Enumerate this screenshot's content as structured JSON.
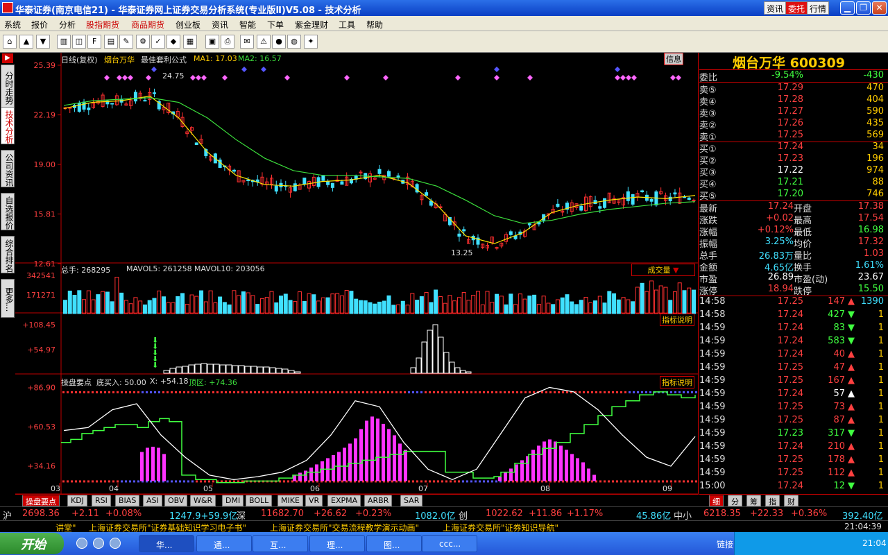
{
  "window": {
    "title": "华泰证券(南京电信21) - 华泰证券网上证券交易分析系统(专业版Ⅱ)V5.08 - 技术分析",
    "title_buttons": [
      "资讯",
      "委托",
      "行情"
    ]
  },
  "menu": [
    {
      "label": "系统",
      "red": false
    },
    {
      "label": "报价",
      "red": false
    },
    {
      "label": "分析",
      "red": false
    },
    {
      "label": "股指期货",
      "red": true
    },
    {
      "label": "商品期货",
      "red": true
    },
    {
      "label": "创业板",
      "red": false
    },
    {
      "label": "资讯",
      "red": false
    },
    {
      "label": "智能",
      "red": false
    },
    {
      "label": "下单",
      "red": false
    },
    {
      "label": "紫金理财",
      "red": false
    },
    {
      "label": "工具",
      "red": false
    },
    {
      "label": "帮助",
      "red": false
    }
  ],
  "left_nav": [
    "分时走势",
    "技术分析",
    "公司资讯",
    "自选报价",
    "综合排名",
    "更多..."
  ],
  "chart_header": {
    "period": "日线(复权)",
    "stock": "烟台万华",
    "formula": "最佳套利公式",
    "ma1": "MA1: 17.03",
    "ma2": "MA2: 16.57",
    "info_button": "信息",
    "high_label": "24.75",
    "low_label": "13.25"
  },
  "price_axis": [
    "25.39",
    "22.19",
    "19.00",
    "15.81",
    "12.61"
  ],
  "volume_header": {
    "label": "总手: 268295",
    "mavol5": "MAVOL5: 261258",
    "mavol10": "MAVOL10: 203056",
    "dropdown": "成交量",
    "axis": [
      "342541",
      "171271"
    ],
    "explain": "指标说明"
  },
  "ind1": {
    "axis": [
      "+108.45",
      "+54.97"
    ],
    "explain": "指标说明"
  },
  "ind2": {
    "name": "操盘要点",
    "buy": "底买入: 50.00",
    "x": "X: +54.18",
    "top": "顶区: +74.36",
    "axis": [
      "+86.90",
      "+60.53",
      "+34.16"
    ],
    "explain": "指标说明"
  },
  "x_axis": [
    "03",
    "04",
    "05",
    "06",
    "07",
    "08",
    "09"
  ],
  "indicator_tabs": [
    "操盘要点",
    "KDJ",
    "RSI",
    "BIAS",
    "ASI",
    "OBV",
    "W&R",
    "DMI",
    "BOLL",
    "MIKE",
    "VR",
    "EXPMA",
    "ARBR",
    "SAR"
  ],
  "quote": {
    "name": "烟台万华 600309",
    "weibi": {
      "label": "委比",
      "pct": "-9.54%",
      "diff": "-430"
    },
    "sell": [
      {
        "label": "卖⑤",
        "price": "17.29",
        "vol": "470"
      },
      {
        "label": "卖④",
        "price": "17.28",
        "vol": "404"
      },
      {
        "label": "卖③",
        "price": "17.27",
        "vol": "590"
      },
      {
        "label": "卖②",
        "price": "17.26",
        "vol": "435"
      },
      {
        "label": "卖①",
        "price": "17.25",
        "vol": "569"
      }
    ],
    "buy": [
      {
        "label": "买①",
        "price": "17.24",
        "vol": "34"
      },
      {
        "label": "买②",
        "price": "17.23",
        "vol": "196"
      },
      {
        "label": "买③",
        "price": "17.22",
        "vol": "974"
      },
      {
        "label": "买④",
        "price": "17.21",
        "vol": "88"
      },
      {
        "label": "买⑤",
        "price": "17.20",
        "vol": "746"
      }
    ],
    "stats": [
      {
        "l1": "最新",
        "v1": "17.24",
        "l2": "开盘",
        "v2": "17.38",
        "c1": "#ff4040",
        "c2": "#ff4040"
      },
      {
        "l1": "涨跌",
        "v1": "+0.02",
        "l2": "最高",
        "v2": "17.54",
        "c1": "#ff4040",
        "c2": "#ff4040"
      },
      {
        "l1": "涨幅",
        "v1": "+0.12%",
        "l2": "最低",
        "v2": "16.98",
        "c1": "#ff4040",
        "c2": "#40ff40"
      },
      {
        "l1": "振幅",
        "v1": "3.25%",
        "l2": "均价",
        "v2": "17.32",
        "c1": "#40e0ff",
        "c2": "#ff4040"
      },
      {
        "l1": "总手",
        "v1": "26.83万",
        "l2": "量比",
        "v2": "1.03",
        "c1": "#40e0ff",
        "c2": "#ff4040"
      },
      {
        "l1": "金额",
        "v1": "4.65亿",
        "l2": "换手",
        "v2": "1.61%",
        "c1": "#40e0ff",
        "c2": "#40e0ff"
      },
      {
        "l1": "市盈",
        "v1": "26.89",
        "l2": "市盈(动)",
        "v2": "23.67",
        "c1": "#ffffff",
        "c2": "#ffffff"
      },
      {
        "l1": "涨停",
        "v1": "18.94",
        "l2": "跌停",
        "v2": "15.50",
        "c1": "#ff4040",
        "c2": "#40ff40"
      }
    ],
    "ticks": [
      {
        "time": "14:58",
        "price": "17.25",
        "vol": "147",
        "dir": "up",
        "extra": "1390"
      },
      {
        "time": "14:58",
        "price": "17.24",
        "vol": "427",
        "dir": "down",
        "extra": "1"
      },
      {
        "time": "14:59",
        "price": "17.24",
        "vol": "83",
        "dir": "down",
        "extra": "1"
      },
      {
        "time": "14:59",
        "price": "17.24",
        "vol": "583",
        "dir": "down",
        "extra": "1"
      },
      {
        "time": "14:59",
        "price": "17.24",
        "vol": "40",
        "dir": "up",
        "extra": "1"
      },
      {
        "time": "14:59",
        "price": "17.25",
        "vol": "47",
        "dir": "up",
        "extra": "1"
      },
      {
        "time": "14:59",
        "price": "17.25",
        "vol": "167",
        "dir": "up",
        "extra": "1"
      },
      {
        "time": "14:59",
        "price": "17.24",
        "vol": "57",
        "dir": "neutral",
        "extra": "1"
      },
      {
        "time": "14:59",
        "price": "17.25",
        "vol": "73",
        "dir": "up",
        "extra": "1"
      },
      {
        "time": "14:59",
        "price": "17.25",
        "vol": "87",
        "dir": "up",
        "extra": "1"
      },
      {
        "time": "14:59",
        "price": "17.23",
        "vol": "317",
        "dir": "down",
        "extra": "1"
      },
      {
        "time": "14:59",
        "price": "17.24",
        "vol": "210",
        "dir": "up",
        "extra": "1"
      },
      {
        "time": "14:59",
        "price": "17.25",
        "vol": "178",
        "dir": "up",
        "extra": "1"
      },
      {
        "time": "14:59",
        "price": "17.25",
        "vol": "112",
        "dir": "up",
        "extra": "1"
      },
      {
        "time": "15:00",
        "price": "17.24",
        "vol": "12",
        "dir": "down",
        "extra": "1"
      }
    ],
    "tabs": [
      "细",
      "分",
      "筹",
      "指",
      "财"
    ]
  },
  "status": {
    "sh_label": "沪",
    "sh_index": "2698.36",
    "sh_change": "+2.11",
    "sh_pct": "+0.08%",
    "sh_amount": "1247.9+59.9亿",
    "sz_label": "深",
    "sz_index": "11682.70",
    "sz_change": "+26.62",
    "sz_pct": "+0.23%",
    "sz_amount": "1082.0亿",
    "cy_label": "创",
    "cy_index": "1022.62",
    "cy_change": "+11.86",
    "cy_pct": "+1.17%",
    "cy_amount": "45.86亿",
    "zx_label": "中小",
    "zx_index": "6218.35",
    "zx_change": "+22.33",
    "zx_pct": "+0.36%",
    "zx_amount": "392.40亿"
  },
  "ticker": {
    "items": [
      "讲堂\"",
      "上海证券交易所\"证券基础知识学习电子书\"",
      "上海证券交易所\"交易流程教学演示动画\"",
      "上海证券交易所\"证券知识导航\""
    ],
    "time": "21:04:39"
  },
  "taskbar": {
    "start": "开始",
    "tasks": [
      "华...",
      "通...",
      "互...",
      "理...",
      "图...",
      "ccc..."
    ],
    "tray_label": "链接",
    "clock": "21:04"
  },
  "colors": {
    "up": "#ff3030",
    "down": "#40e0ff",
    "green": "#40ff40",
    "axis": "#c00000",
    "yellow": "#ffcc00"
  },
  "chart_data": [
    {
      "type": "line",
      "title": "日线(复权) 烟台万华",
      "ylim": [
        12.61,
        25.39
      ],
      "yticks": [
        25.39,
        22.19,
        19.0,
        15.81,
        12.61
      ],
      "x": [
        "03",
        "04",
        "05",
        "06",
        "07",
        "08",
        "09"
      ],
      "series": [
        {
          "name": "MA1",
          "values": [
            22.6,
            23.0,
            23.1,
            23.4,
            22.0,
            19.8,
            18.3,
            17.7,
            17.6,
            17.9,
            18.0,
            18.3,
            17.8,
            16.4,
            14.4,
            13.9,
            14.6,
            15.9,
            16.4,
            16.7,
            16.9,
            16.8,
            17.0
          ]
        },
        {
          "name": "MA2",
          "values": [
            22.8,
            23.1,
            23.2,
            23.3,
            23.0,
            22.0,
            20.6,
            19.4,
            18.6,
            18.3,
            18.3,
            18.2,
            18.1,
            17.6,
            16.7,
            15.7,
            15.2,
            15.4,
            15.8,
            16.1,
            16.3,
            16.5,
            16.6
          ]
        }
      ]
    },
    {
      "type": "bar",
      "title": "成交量",
      "ylim": [
        0,
        342541
      ],
      "yticks": [
        342541,
        171271
      ]
    },
    {
      "type": "line",
      "title": "操盘要点",
      "ylim": [
        20,
        90
      ],
      "yticks": [
        86.9,
        60.53,
        34.16
      ],
      "series": [
        {
          "name": "X",
          "values": [
            58,
            60,
            72,
            76,
            55,
            40,
            28,
            25,
            27,
            30,
            38,
            55,
            78,
            74,
            50,
            32,
            25,
            32,
            56,
            80,
            87,
            84,
            72,
            55,
            40,
            34,
            54
          ]
        }
      ]
    }
  ]
}
